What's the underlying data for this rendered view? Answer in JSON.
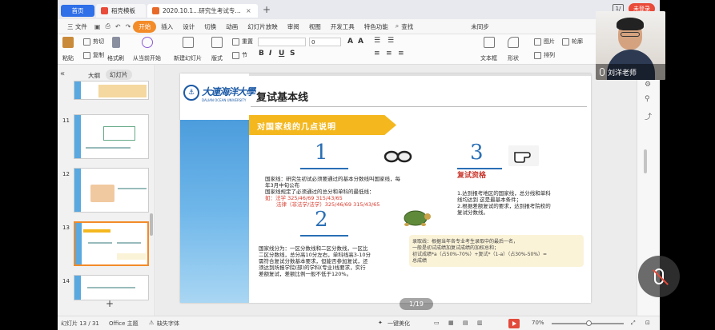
{
  "titlebar": {
    "tabs": [
      {
        "label": "首页",
        "color": "#2f6fe8"
      },
      {
        "label": "稻壳模板",
        "color": "#e94a3a"
      },
      {
        "label": "2020.10.1...研究生考试专题讲座",
        "color": "#e86a2a"
      }
    ],
    "add_tab": "+",
    "close": "×",
    "badge": "1/",
    "login": "未登录"
  },
  "menubar": {
    "file": "三 文件",
    "items": [
      "开始",
      "插入",
      "设计",
      "切换",
      "动画",
      "幻灯片放映",
      "审阅",
      "视图",
      "开发工具",
      "特色功能"
    ],
    "active": "开始",
    "search": "查找",
    "sync": "未同步",
    "coop": "协作"
  },
  "ribbon": {
    "cut": "剪切",
    "copy": "复制",
    "format_painter": "格式刷",
    "paste": "粘贴",
    "play_from_current": "从当前开始",
    "new_slide": "新建幻灯片",
    "layout": "版式",
    "section": "节",
    "reset": "重置",
    "textbox": "文本框",
    "shape": "形状",
    "arrange": "排列",
    "picture": "图片",
    "outline": "轮廓",
    "font_size": "0"
  },
  "leftpanel": {
    "outline_tab": "大纲",
    "slides_tab": "幻灯片",
    "thumbnails": [
      {
        "num": "",
        "selected": false
      },
      {
        "num": "11",
        "selected": false
      },
      {
        "num": "12",
        "selected": false
      },
      {
        "num": "13",
        "selected": true
      },
      {
        "num": "14",
        "selected": false
      }
    ],
    "add": "+"
  },
  "slide": {
    "logo_cn": "大連海洋大學",
    "logo_en": "DALIAN OCEAN UNIVERSITY",
    "title": "复试基本线",
    "banner": "对国家线的几点说明",
    "num1": "1",
    "num2": "2",
    "num3": "3",
    "block1": [
      "国家线：研究生初试必须要通过的基本分数线叫国家线，每",
      "年3月中旬公布",
      "国家线规定了必须通过的总分和单科的最低线："
    ],
    "block1_red1": "如：法学 325/46/69   315/43/65",
    "block1_red2": "法律（非法学/法学）325/46/69   315/43/65",
    "block2": [
      "国家线分为：一区分数线和二区分数线，一区比",
      "二区分数线，总分高10分左右，单科线高3-10分",
      "需符合复试分数基本要求，但能否参加复试，还",
      "须达到所报学院(部)的学科(专业)线要求，实行",
      "差额复试，差额比例一般不低于120%。"
    ],
    "heading3": "复试资格",
    "block3": [
      "1.达到报考地区的国家线，总分线和单科",
      "线均达到 这是最基本条件；",
      "2.根据差额复试的要求，达到报考院校的",
      "复试分数线。"
    ],
    "note": [
      "录取线：根据当年各专业考生录取中的最后一名，",
      "一般是初试成绩加复试成绩的加权总和；",
      "初试成绩*a（占50%-70%）+复试*（1-a）（占30%-50%）=",
      "总成绩"
    ],
    "page_indicator": "1/19"
  },
  "statusbar": {
    "slide_count": "幻灯片 13 / 31",
    "theme": "Office 主题",
    "font_missing": "缺失字体",
    "beautify": "一键美化",
    "zoom": "70%"
  },
  "video": {
    "name": "刘洋老师"
  },
  "colors": {
    "accent": "#f28b28",
    "brand_blue": "#2f6fe8",
    "slide_blue": "#3b8fd6",
    "banner_yellow": "#f4b81e",
    "red_text": "#d63a2c"
  }
}
